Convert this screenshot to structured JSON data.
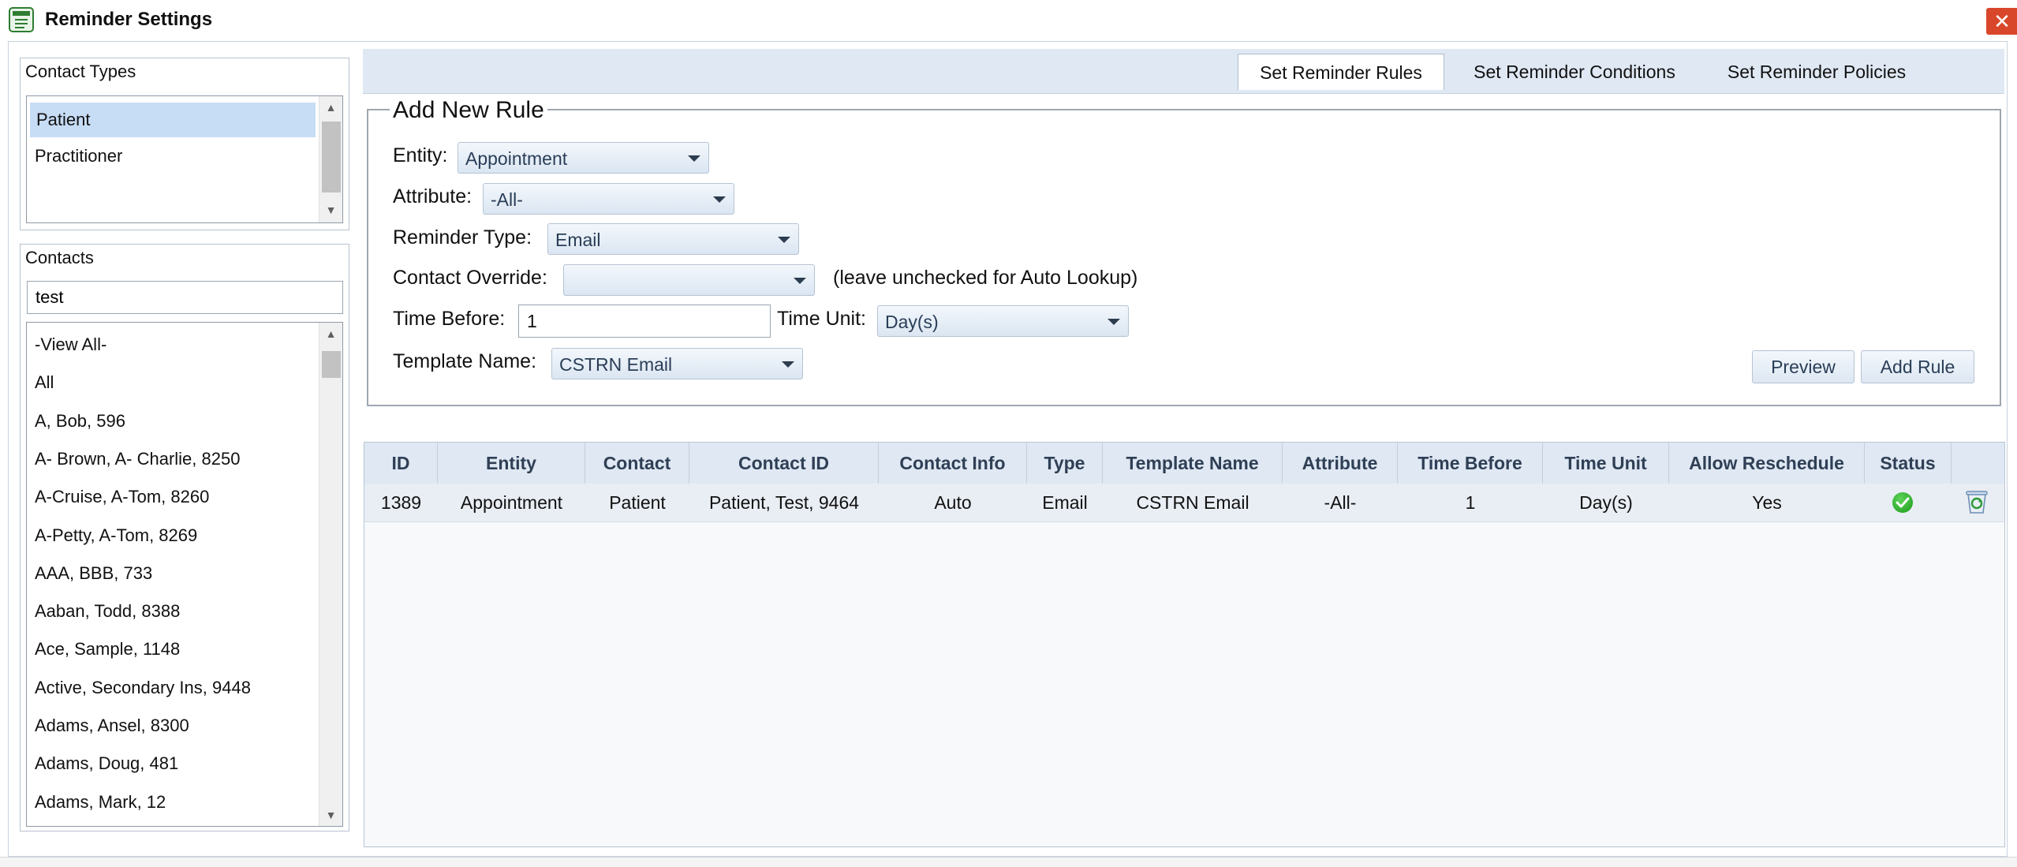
{
  "window": {
    "title": "Reminder Settings",
    "close_glyph": "✕"
  },
  "contact_types": {
    "title": "Contact Types",
    "items": [
      "Patient",
      "Practitioner"
    ],
    "selected": "Patient"
  },
  "contacts": {
    "title": "Contacts",
    "search_value": "test",
    "items": [
      "-View All-",
      "All",
      "A, Bob, 596",
      "A- Brown, A- Charlie, 8250",
      "A-Cruise, A-Tom, 8260",
      "A-Petty, A-Tom, 8269",
      "AAA, BBB, 733",
      "Aaban, Todd, 8388",
      "Ace, Sample, 1148",
      "Active, Secondary Ins, 9448",
      "Adams, Ansel, 8300",
      "Adams, Doug, 481",
      "Adams, Mark, 12"
    ]
  },
  "tabs": {
    "rules": "Set Reminder Rules",
    "conditions": "Set Reminder Conditions",
    "policies": "Set Reminder Policies",
    "active": "rules"
  },
  "form": {
    "legend": "Add New Rule",
    "entity_label": "Entity:",
    "entity_value": "Appointment",
    "attribute_label": "Attribute:",
    "attribute_value": "-All-",
    "reminder_type_label": "Reminder Type:",
    "reminder_type_value": "Email",
    "contact_override_label": "Contact Override:",
    "contact_override_value": "",
    "contact_override_hint": "(leave unchecked for Auto Lookup)",
    "time_before_label": "Time Before:",
    "time_before_value": "1",
    "time_unit_label": "Time Unit:",
    "time_unit_value": "Day(s)",
    "template_name_label": "Template Name:",
    "template_name_value": "CSTRN Email",
    "preview_button": "Preview",
    "add_rule_button": "Add Rule"
  },
  "grid": {
    "columns": [
      "ID",
      "Entity",
      "Contact",
      "Contact ID",
      "Contact Info",
      "Type",
      "Template Name",
      "Attribute",
      "Time Before",
      "Time Unit",
      "Allow Reschedule",
      "Status"
    ],
    "rows": [
      {
        "id": "1389",
        "entity": "Appointment",
        "contact": "Patient",
        "contact_id": "Patient, Test, 9464",
        "contact_info": "Auto",
        "type": "Email",
        "template_name": "CSTRN Email",
        "attribute": "-All-",
        "time_before": "1",
        "time_unit": "Day(s)",
        "allow_reschedule": "Yes",
        "status_icon": "check-circle-icon",
        "delete_icon": "recycle-bin-icon"
      }
    ]
  },
  "colors": {
    "accent_tab_strip": "#dfe8f3",
    "selected_item": "#c7dcf5",
    "close_button": "#d9472b",
    "status_ok": "#1a9a1a"
  }
}
